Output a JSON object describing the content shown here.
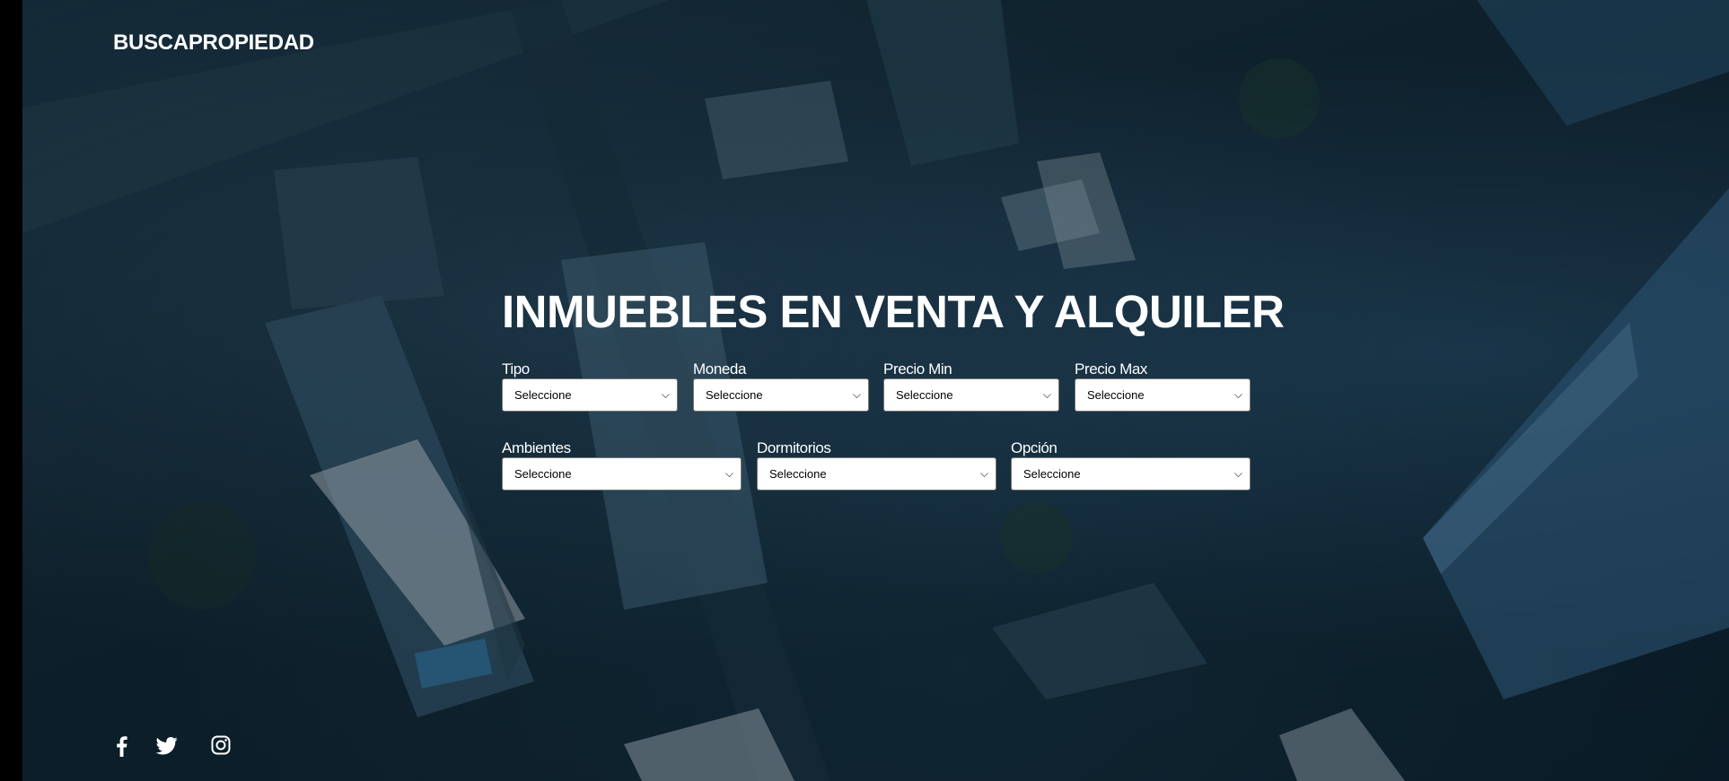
{
  "brand": {
    "name": "BUSCAPROPIEDAD"
  },
  "hero": {
    "title": "INMUEBLES EN VENTA Y ALQUILER"
  },
  "filters": {
    "tipo": {
      "label": "Tipo",
      "value": "Seleccione"
    },
    "moneda": {
      "label": "Moneda",
      "value": "Seleccione"
    },
    "precio_min": {
      "label": "Precio Min",
      "value": "Seleccione"
    },
    "precio_max": {
      "label": "Precio Max",
      "value": "Seleccione"
    },
    "ambientes": {
      "label": "Ambientes",
      "value": "Seleccione"
    },
    "dormitorios": {
      "label": "Dormitorios",
      "value": "Seleccione"
    },
    "opcion": {
      "label": "Opción",
      "value": "Seleccione"
    }
  },
  "social": [
    "facebook-icon",
    "twitter-icon",
    "instagram-icon"
  ],
  "colors": {
    "overlay": "#0f2430",
    "text": "#ffffff",
    "select_bg": "#ffffff"
  }
}
